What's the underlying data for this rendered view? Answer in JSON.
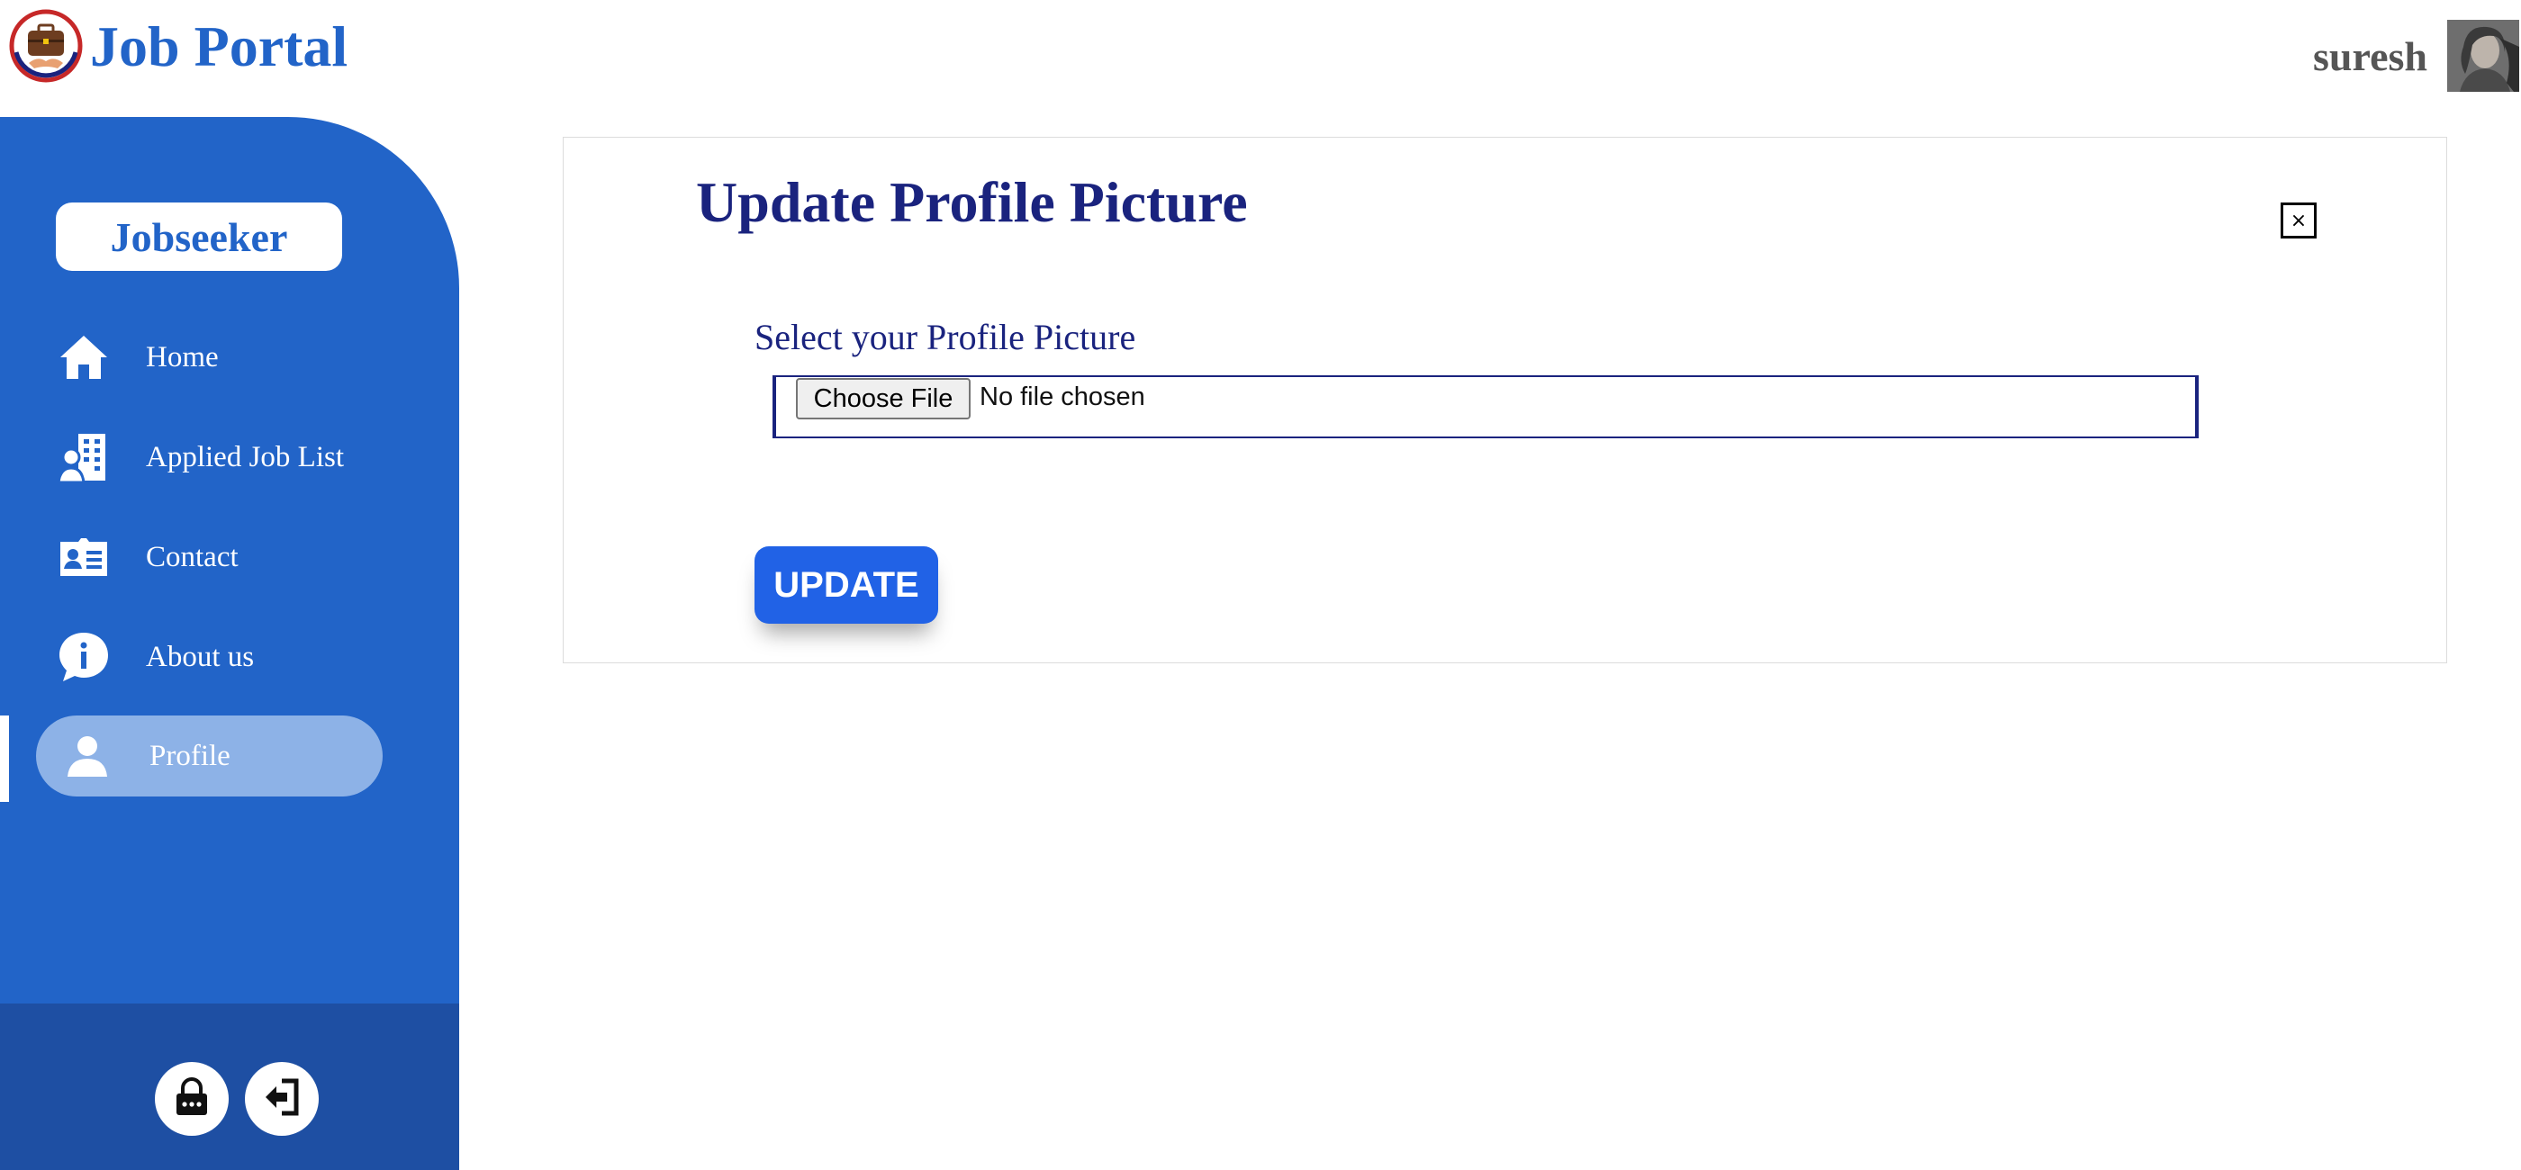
{
  "app": {
    "title": "Job Portal"
  },
  "header": {
    "username": "suresh"
  },
  "sidebar": {
    "role_label": "Jobseeker",
    "items": [
      {
        "label": "Home",
        "icon": "home-icon"
      },
      {
        "label": "Applied Job List",
        "icon": "applied-jobs-icon"
      },
      {
        "label": "Contact",
        "icon": "contact-card-icon"
      },
      {
        "label": "About us",
        "icon": "info-bubble-icon"
      },
      {
        "label": "Profile",
        "icon": "user-icon",
        "active": true
      }
    ],
    "footer_buttons": [
      {
        "icon": "lock-icon"
      },
      {
        "icon": "logout-icon"
      }
    ]
  },
  "main": {
    "title": "Update Profile Picture",
    "close_symbol": "×",
    "field_label": "Select your Profile Picture",
    "choose_button_label": "Choose File",
    "file_status": "No file chosen",
    "update_button_label": "UPDATE"
  },
  "colors": {
    "brand_blue": "#2264c8",
    "sidebar_footer": "#1e4fa3",
    "active_item": "#8db2e7",
    "title_navy": "#1a237e",
    "update_button": "#2162e6"
  }
}
